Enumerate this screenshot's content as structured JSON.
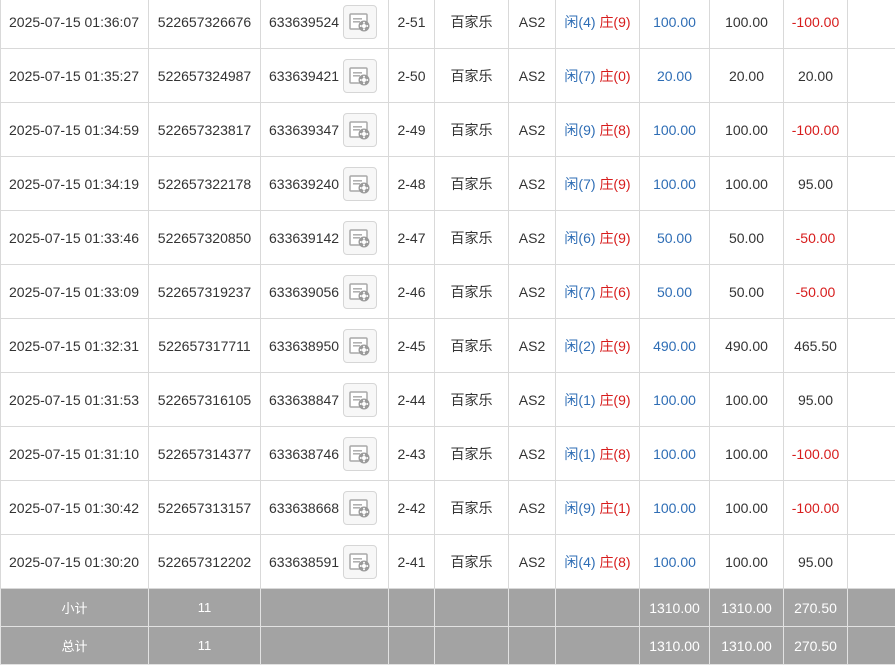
{
  "rows": [
    {
      "time": "2025-07-15 01:36:07",
      "bet_id": "522657326676",
      "round_id": "633639524",
      "shoe": "2-51",
      "game": "百家乐",
      "table": "AS2",
      "player": "闲(4)",
      "banker": "庄(9)",
      "amount": "100.00",
      "valid": "100.00",
      "winloss": "-100.00",
      "neg": true
    },
    {
      "time": "2025-07-15 01:35:27",
      "bet_id": "522657324987",
      "round_id": "633639421",
      "shoe": "2-50",
      "game": "百家乐",
      "table": "AS2",
      "player": "闲(7)",
      "banker": "庄(0)",
      "amount": "20.00",
      "valid": "20.00",
      "winloss": "20.00",
      "neg": false
    },
    {
      "time": "2025-07-15 01:34:59",
      "bet_id": "522657323817",
      "round_id": "633639347",
      "shoe": "2-49",
      "game": "百家乐",
      "table": "AS2",
      "player": "闲(9)",
      "banker": "庄(8)",
      "amount": "100.00",
      "valid": "100.00",
      "winloss": "-100.00",
      "neg": true
    },
    {
      "time": "2025-07-15 01:34:19",
      "bet_id": "522657322178",
      "round_id": "633639240",
      "shoe": "2-48",
      "game": "百家乐",
      "table": "AS2",
      "player": "闲(7)",
      "banker": "庄(9)",
      "amount": "100.00",
      "valid": "100.00",
      "winloss": "95.00",
      "neg": false
    },
    {
      "time": "2025-07-15 01:33:46",
      "bet_id": "522657320850",
      "round_id": "633639142",
      "shoe": "2-47",
      "game": "百家乐",
      "table": "AS2",
      "player": "闲(6)",
      "banker": "庄(9)",
      "amount": "50.00",
      "valid": "50.00",
      "winloss": "-50.00",
      "neg": true
    },
    {
      "time": "2025-07-15 01:33:09",
      "bet_id": "522657319237",
      "round_id": "633639056",
      "shoe": "2-46",
      "game": "百家乐",
      "table": "AS2",
      "player": "闲(7)",
      "banker": "庄(6)",
      "amount": "50.00",
      "valid": "50.00",
      "winloss": "-50.00",
      "neg": true
    },
    {
      "time": "2025-07-15 01:32:31",
      "bet_id": "522657317711",
      "round_id": "633638950",
      "shoe": "2-45",
      "game": "百家乐",
      "table": "AS2",
      "player": "闲(2)",
      "banker": "庄(9)",
      "amount": "490.00",
      "valid": "490.00",
      "winloss": "465.50",
      "neg": false
    },
    {
      "time": "2025-07-15 01:31:53",
      "bet_id": "522657316105",
      "round_id": "633638847",
      "shoe": "2-44",
      "game": "百家乐",
      "table": "AS2",
      "player": "闲(1)",
      "banker": "庄(9)",
      "amount": "100.00",
      "valid": "100.00",
      "winloss": "95.00",
      "neg": false
    },
    {
      "time": "2025-07-15 01:31:10",
      "bet_id": "522657314377",
      "round_id": "633638746",
      "shoe": "2-43",
      "game": "百家乐",
      "table": "AS2",
      "player": "闲(1)",
      "banker": "庄(8)",
      "amount": "100.00",
      "valid": "100.00",
      "winloss": "-100.00",
      "neg": true
    },
    {
      "time": "2025-07-15 01:30:42",
      "bet_id": "522657313157",
      "round_id": "633638668",
      "shoe": "2-42",
      "game": "百家乐",
      "table": "AS2",
      "player": "闲(9)",
      "banker": "庄(1)",
      "amount": "100.00",
      "valid": "100.00",
      "winloss": "-100.00",
      "neg": true
    },
    {
      "time": "2025-07-15 01:30:20",
      "bet_id": "522657312202",
      "round_id": "633638591",
      "shoe": "2-41",
      "game": "百家乐",
      "table": "AS2",
      "player": "闲(4)",
      "banker": "庄(8)",
      "amount": "100.00",
      "valid": "100.00",
      "winloss": "95.00",
      "neg": false
    }
  ],
  "subtotal": {
    "label": "小计",
    "count": "11",
    "amount": "1310.00",
    "valid": "1310.00",
    "winloss": "270.50"
  },
  "total": {
    "label": "总计",
    "count": "11",
    "amount": "1310.00",
    "valid": "1310.00",
    "winloss": "270.50"
  },
  "colors": {
    "player": "#2e6db5",
    "banker": "#d71c1c",
    "loss": "#d71c1c",
    "summary_bg": "#a3a3a3"
  },
  "icons": {
    "replay": "video-replay-icon"
  }
}
